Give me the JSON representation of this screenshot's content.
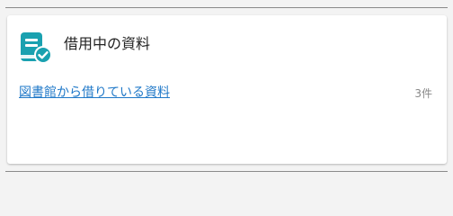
{
  "colors": {
    "accent": "#1aa1b0",
    "link": "#1f78c8",
    "count_text": "#888888"
  },
  "card": {
    "icon": "book-check-icon",
    "title": "借用中の資料",
    "link_label": "図書館から借りている資料",
    "count": "3件"
  }
}
